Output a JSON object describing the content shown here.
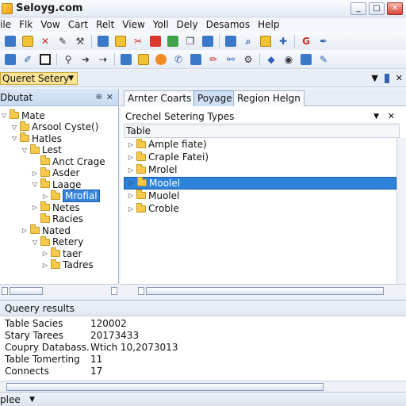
{
  "window": {
    "title": "Seloyg.com",
    "buttons": [
      "_",
      "□",
      "✕"
    ]
  },
  "menu": [
    "ile",
    "Flk",
    "Vow",
    "Cart",
    "Relt",
    "View",
    "Yoll",
    "Dely",
    "Desamos",
    "Help"
  ],
  "query_bar": {
    "selected": "Queret Setery"
  },
  "left_panel": {
    "title": "Dbutat",
    "tree": [
      {
        "label": "Mate",
        "indent": 0,
        "arrow": "▽"
      },
      {
        "label": "Arsool Cyste()",
        "indent": 1,
        "arrow": "▽"
      },
      {
        "label": "Hatles",
        "indent": 1,
        "arrow": "▽"
      },
      {
        "label": "Lest",
        "indent": 2,
        "arrow": "▽"
      },
      {
        "label": "Anct Crage",
        "indent": 3,
        "arrow": ""
      },
      {
        "label": "Asder",
        "indent": 3,
        "arrow": "▷"
      },
      {
        "label": "Laage",
        "indent": 3,
        "arrow": "▽"
      },
      {
        "label": "Mrofial",
        "indent": 4,
        "arrow": "▷",
        "selected": true
      },
      {
        "label": "Netes",
        "indent": 3,
        "arrow": "▷"
      },
      {
        "label": "Racies",
        "indent": 3,
        "arrow": ""
      },
      {
        "label": "Nated",
        "indent": 2,
        "arrow": "▷"
      },
      {
        "label": "Retery",
        "indent": 3,
        "arrow": "▽"
      },
      {
        "label": "taer",
        "indent": 4,
        "arrow": "▷"
      },
      {
        "label": "Tadres",
        "indent": 4,
        "arrow": "▷"
      }
    ]
  },
  "right_panel": {
    "tabs": [
      {
        "label": "Arnter Coarts",
        "active": false
      },
      {
        "label": "Poyage",
        "active": true
      },
      {
        "label": "Region Helgn",
        "active": false
      }
    ],
    "combo": "Crechel Setering Types",
    "table_header": "Table",
    "rows": [
      {
        "label": "Ample fiate)",
        "selected": false
      },
      {
        "label": "Craple Fatei)",
        "selected": false
      },
      {
        "label": "Mrolel",
        "selected": false
      },
      {
        "label": "Moolel",
        "selected": true
      },
      {
        "label": "Muolel",
        "selected": false
      },
      {
        "label": "Croble",
        "selected": false
      }
    ]
  },
  "results": {
    "title": "Queery results",
    "rows": [
      {
        "label": "Table Sacies",
        "value": "120002"
      },
      {
        "label": "Stary Tarees",
        "value": "20173433"
      },
      {
        "label": "Coupry Databass.",
        "value": "Wtich 10,2073013"
      },
      {
        "label": "Table Tomerting",
        "value": "11"
      },
      {
        "label": "Connects",
        "value": "17"
      }
    ]
  },
  "status": {
    "selected": "plee"
  }
}
